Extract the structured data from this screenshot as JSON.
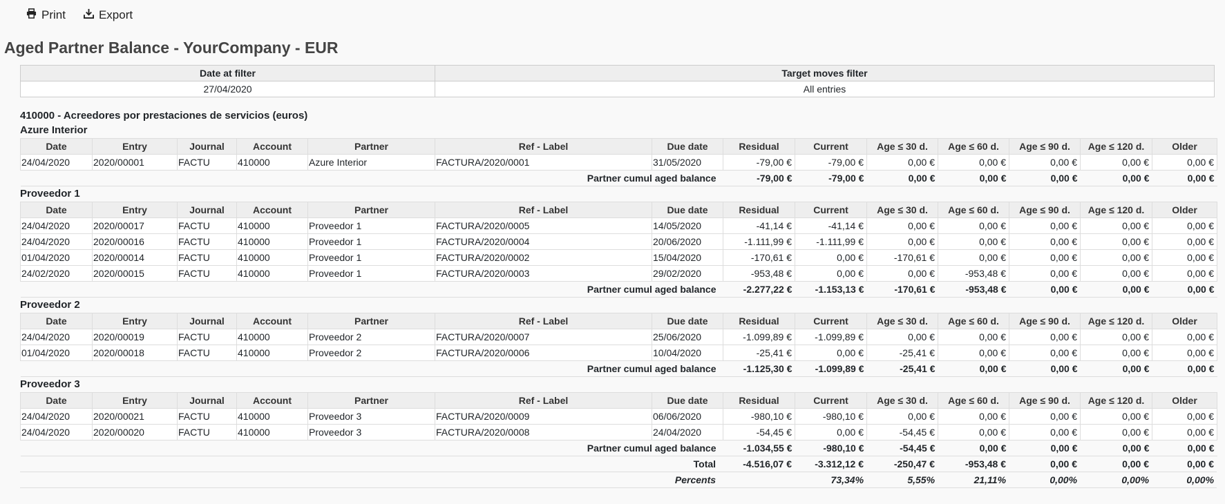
{
  "toolbar": {
    "print_label": "Print",
    "export_label": "Export"
  },
  "page_title": "Aged Partner Balance - YourCompany - EUR",
  "filters": {
    "headers": [
      "Date at filter",
      "Target moves filter"
    ],
    "values": [
      "27/04/2020",
      "All entries"
    ]
  },
  "account_title": "410000 - Acreedores por prestaciones de servicios (euros)",
  "columns": [
    "Date",
    "Entry",
    "Journal",
    "Account",
    "Partner",
    "Ref - Label",
    "Due date",
    "Residual",
    "Current",
    "Age ≤ 30 d.",
    "Age ≤ 60 d.",
    "Age ≤ 90 d.",
    "Age ≤ 120 d.",
    "Older"
  ],
  "cumul_label": "Partner cumul aged balance",
  "partners": [
    {
      "name": "Azure Interior",
      "rows": [
        [
          "24/04/2020",
          "2020/00001",
          "FACTU",
          "410000",
          "Azure Interior",
          "FACTURA/2020/0001",
          "31/05/2020",
          "-79,00 €",
          "-79,00 €",
          "0,00 €",
          "0,00 €",
          "0,00 €",
          "0,00 €",
          "0,00 €"
        ]
      ],
      "cumul": [
        "-79,00 €",
        "-79,00 €",
        "0,00 €",
        "0,00 €",
        "0,00 €",
        "0,00 €",
        "0,00 €"
      ]
    },
    {
      "name": "Proveedor 1",
      "rows": [
        [
          "24/04/2020",
          "2020/00017",
          "FACTU",
          "410000",
          "Proveedor 1",
          "FACTURA/2020/0005",
          "14/05/2020",
          "-41,14 €",
          "-41,14 €",
          "0,00 €",
          "0,00 €",
          "0,00 €",
          "0,00 €",
          "0,00 €"
        ],
        [
          "24/04/2020",
          "2020/00016",
          "FACTU",
          "410000",
          "Proveedor 1",
          "FACTURA/2020/0004",
          "20/06/2020",
          "-1.111,99 €",
          "-1.111,99 €",
          "0,00 €",
          "0,00 €",
          "0,00 €",
          "0,00 €",
          "0,00 €"
        ],
        [
          "01/04/2020",
          "2020/00014",
          "FACTU",
          "410000",
          "Proveedor 1",
          "FACTURA/2020/0002",
          "15/04/2020",
          "-170,61 €",
          "0,00 €",
          "-170,61 €",
          "0,00 €",
          "0,00 €",
          "0,00 €",
          "0,00 €"
        ],
        [
          "24/02/2020",
          "2020/00015",
          "FACTU",
          "410000",
          "Proveedor 1",
          "FACTURA/2020/0003",
          "29/02/2020",
          "-953,48 €",
          "0,00 €",
          "0,00 €",
          "-953,48 €",
          "0,00 €",
          "0,00 €",
          "0,00 €"
        ]
      ],
      "cumul": [
        "-2.277,22 €",
        "-1.153,13 €",
        "-170,61 €",
        "-953,48 €",
        "0,00 €",
        "0,00 €",
        "0,00 €"
      ]
    },
    {
      "name": "Proveedor 2",
      "rows": [
        [
          "24/04/2020",
          "2020/00019",
          "FACTU",
          "410000",
          "Proveedor 2",
          "FACTURA/2020/0007",
          "25/06/2020",
          "-1.099,89 €",
          "-1.099,89 €",
          "0,00 €",
          "0,00 €",
          "0,00 €",
          "0,00 €",
          "0,00 €"
        ],
        [
          "01/04/2020",
          "2020/00018",
          "FACTU",
          "410000",
          "Proveedor 2",
          "FACTURA/2020/0006",
          "10/04/2020",
          "-25,41 €",
          "0,00 €",
          "-25,41 €",
          "0,00 €",
          "0,00 €",
          "0,00 €",
          "0,00 €"
        ]
      ],
      "cumul": [
        "-1.125,30 €",
        "-1.099,89 €",
        "-25,41 €",
        "0,00 €",
        "0,00 €",
        "0,00 €",
        "0,00 €"
      ]
    },
    {
      "name": "Proveedor 3",
      "rows": [
        [
          "24/04/2020",
          "2020/00021",
          "FACTU",
          "410000",
          "Proveedor 3",
          "FACTURA/2020/0009",
          "06/06/2020",
          "-980,10 €",
          "-980,10 €",
          "0,00 €",
          "0,00 €",
          "0,00 €",
          "0,00 €",
          "0,00 €"
        ],
        [
          "24/04/2020",
          "2020/00020",
          "FACTU",
          "410000",
          "Proveedor 3",
          "FACTURA/2020/0008",
          "24/04/2020",
          "-54,45 €",
          "0,00 €",
          "-54,45 €",
          "0,00 €",
          "0,00 €",
          "0,00 €",
          "0,00 €"
        ]
      ],
      "cumul": [
        "-1.034,55 €",
        "-980,10 €",
        "-54,45 €",
        "0,00 €",
        "0,00 €",
        "0,00 €",
        "0,00 €"
      ]
    }
  ],
  "total": {
    "label": "Total",
    "values": [
      "-4.516,07 €",
      "-3.312,12 €",
      "-250,47 €",
      "-953,48 €",
      "0,00 €",
      "0,00 €",
      "0,00 €"
    ]
  },
  "percents": {
    "label": "Percents",
    "values": [
      "",
      "73,34%",
      "5,55%",
      "21,11%",
      "0,00%",
      "0,00%",
      "0,00%"
    ]
  }
}
